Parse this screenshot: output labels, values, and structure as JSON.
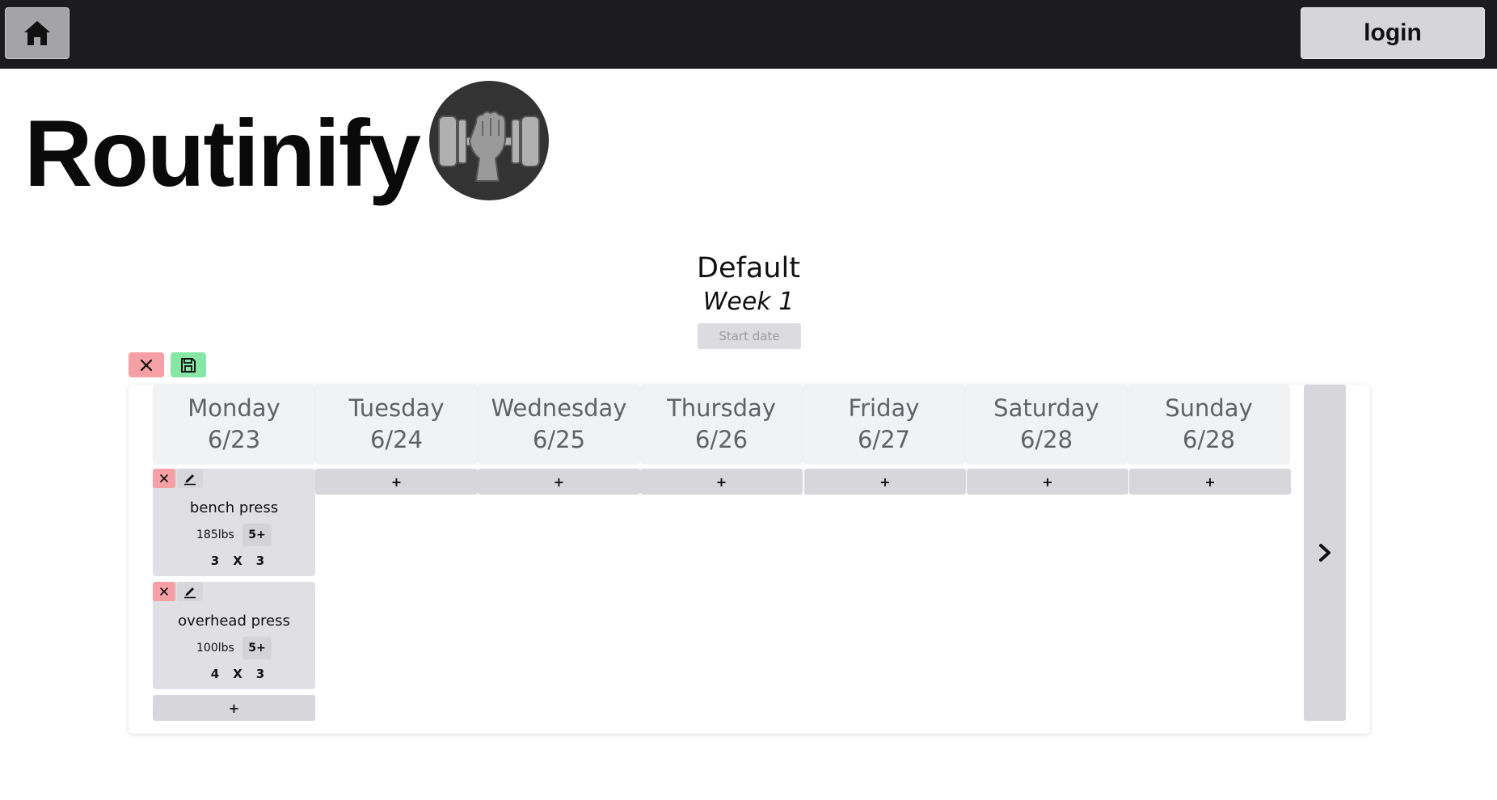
{
  "nav": {
    "home_icon": "home-icon",
    "login_label": "login"
  },
  "brand": {
    "title": "Routinify",
    "logo_icon": "dumbbell-fist-icon"
  },
  "routine": {
    "name": "Default",
    "week": "Week 1",
    "start_date_label": "Start date"
  },
  "toolbar": {
    "cancel_icon": "close-icon",
    "save_icon": "save-icon"
  },
  "days": [
    {
      "name": "Monday",
      "date": "6/23"
    },
    {
      "name": "Tuesday",
      "date": "6/24"
    },
    {
      "name": "Wednesday",
      "date": "6/25"
    },
    {
      "name": "Thursday",
      "date": "6/26"
    },
    {
      "name": "Friday",
      "date": "6/27"
    },
    {
      "name": "Saturday",
      "date": "6/28"
    },
    {
      "name": "Sunday",
      "date": "6/28"
    }
  ],
  "add_label": "+",
  "exercises": [
    {
      "name": "bench press",
      "weight": "185lbs",
      "amrap": "5+",
      "sets": "3",
      "x": "X",
      "reps": "3"
    },
    {
      "name": "overhead press",
      "weight": "100lbs",
      "amrap": "5+",
      "sets": "4",
      "x": "X",
      "reps": "3"
    }
  ],
  "next_icon": "chevron-right-icon",
  "colors": {
    "topbar": "#1b1b20",
    "cancel": "#f4a0a4",
    "save": "#86e6a4",
    "day_header": "#f1f2f4",
    "button_gray": "#d6d6db"
  }
}
